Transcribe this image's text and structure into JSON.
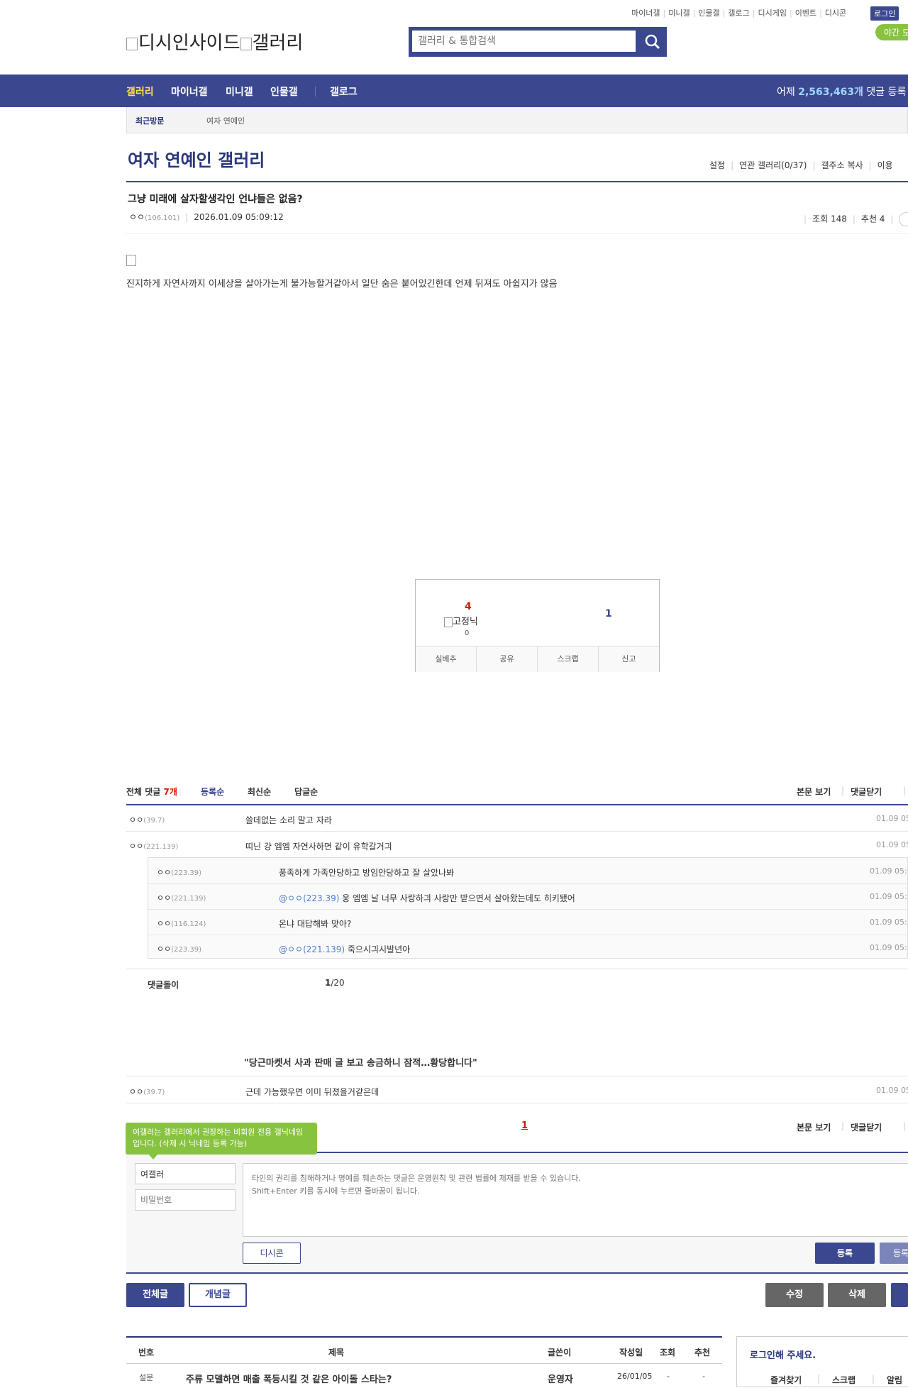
{
  "top_links": [
    "마이너갤",
    "미니갤",
    "인물갤",
    "갤로그",
    "디시게임",
    "이벤트",
    "디시콘"
  ],
  "login_button": "로그인",
  "night_mode": "야간 모드",
  "logo": {
    "brand": "디시인사이드",
    "section": "갤러리"
  },
  "search": {
    "placeholder": "갤러리 & 통합검색"
  },
  "nav": {
    "items": [
      "갤러리",
      "마이너갤",
      "미니갤",
      "인물갤",
      "갤로그"
    ],
    "stat_prefix": "어제",
    "stat_value": "2,563,463개",
    "stat_suffix": "댓글 등록"
  },
  "recent": {
    "label": "최근방문",
    "item": "여자 연예인"
  },
  "gallery": {
    "title": "여자 연예인 갤러리",
    "links": [
      "설정",
      "연관 갤러리(0/37)",
      "갤주소 복사",
      "이용"
    ]
  },
  "post": {
    "title": "그냥 미래에 살자할생각인 언냐들은 없음?",
    "author": "ㅇㅇ",
    "author_ip": "(106.101)",
    "date": "2026.01.09 05:09:12",
    "views_label": "조회 148",
    "recommend_label": "추천 4",
    "body": "진지하게 자연사까지 이세상을 살아가는게 불가능할거같아서 일단 숨은 붙어있긴한데 언제 뒤져도 아쉽지가 않음"
  },
  "vote": {
    "up_count": "4",
    "fixed_img_alt": "고정닉",
    "fixed_count": "0",
    "down_count": "1",
    "actions": [
      "실베추",
      "공유",
      "스크랩",
      "신고"
    ]
  },
  "comments": {
    "total_prefix": "전체 댓글",
    "total_count": "7개",
    "sort": [
      "등록순",
      "최신순",
      "답글순"
    ],
    "right_links": [
      "본문 보기",
      "댓글닫기"
    ],
    "items": [
      {
        "nick": "ㅇㅇ",
        "ip": "(39.7)",
        "text": "쓸데없는 소리 말고 자라",
        "date": "01.09 05"
      },
      {
        "nick": "ㅇㅇ",
        "ip": "(221.139)",
        "text": "띠닌 걍 엠엠 자연사하면 같이 유학갈거긔",
        "date": "01.09 05"
      }
    ],
    "replies": [
      {
        "nick": "ㅇㅇ",
        "ip": "(223.39)",
        "mention": "",
        "text": "풍족하게 가족안당하고 방임안당하고 잘 살았나봐",
        "date": "01.09 05:1"
      },
      {
        "nick": "ㅇㅇ",
        "ip": "(221.139)",
        "mention": "@ㅇㅇ(223.39)",
        "text": " 웅 엠엠 날 너무 사랑하긔 사랑만 받으면서 살아왔는데도 히키됐어",
        "date": "01.09 05:1"
      },
      {
        "nick": "ㅇㅇ",
        "ip": "(116.124)",
        "mention": "",
        "text": "온냐 대답해봐 맞아?",
        "date": "01.09 05:1"
      },
      {
        "nick": "ㅇㅇ",
        "ip": "(223.39)",
        "mention": "@ㅇㅇ(221.139)",
        "text": " 죽으시긔시발년아",
        "date": "01.09 05:1"
      }
    ],
    "dolri_label": "댓글돌이",
    "page_current": "1",
    "page_total": "/20",
    "news_title": "\"당근마켓서 사과 판매 글 보고 송금하니 잠적…황당합니다\"",
    "last": {
      "nick": "ㅇㅇ",
      "ip": "(39.7)",
      "text": "근데 가능했우면 이미 뒤졌을거같은데",
      "date": "01.09 05"
    },
    "page_num": "1"
  },
  "write": {
    "tooltip": "여갤러는 갤러리에서 권장하는 비회원 전용 갤닉네임입니다. (삭제 시 닉네임 등록 가능)",
    "name_value": "여갤러",
    "pw_placeholder": "비밀번호",
    "textarea_placeholder": "타인의 권리를 침해하거나 명예를 훼손하는 댓글은 운영원칙 및 관련 법률에 제재를 받을 수 있습니다.\nShift+Enter 키를 동시에 누르면 줄바꿈이 됩니다.",
    "dccon_label": "디시콘",
    "submit_label": "등록",
    "submit2_label": "등록"
  },
  "bottom_buttons": {
    "all": "전체글",
    "concept": "개념글",
    "edit": "수정",
    "delete": "삭제"
  },
  "list": {
    "headers": [
      "번호",
      "제목",
      "글쓴이",
      "작성일",
      "조회",
      "추천"
    ],
    "row": {
      "num": "설문",
      "title": "주류 모델하면 매출 폭등시킬 것 같은 아이돌 스타는?",
      "writer": "운영자",
      "date": "26/01/05",
      "views": "-",
      "rec": "-"
    }
  },
  "login_panel": {
    "title": "로그인해 주세요.",
    "tabs": [
      "즐겨찾기",
      "스크랩",
      "알림"
    ]
  }
}
